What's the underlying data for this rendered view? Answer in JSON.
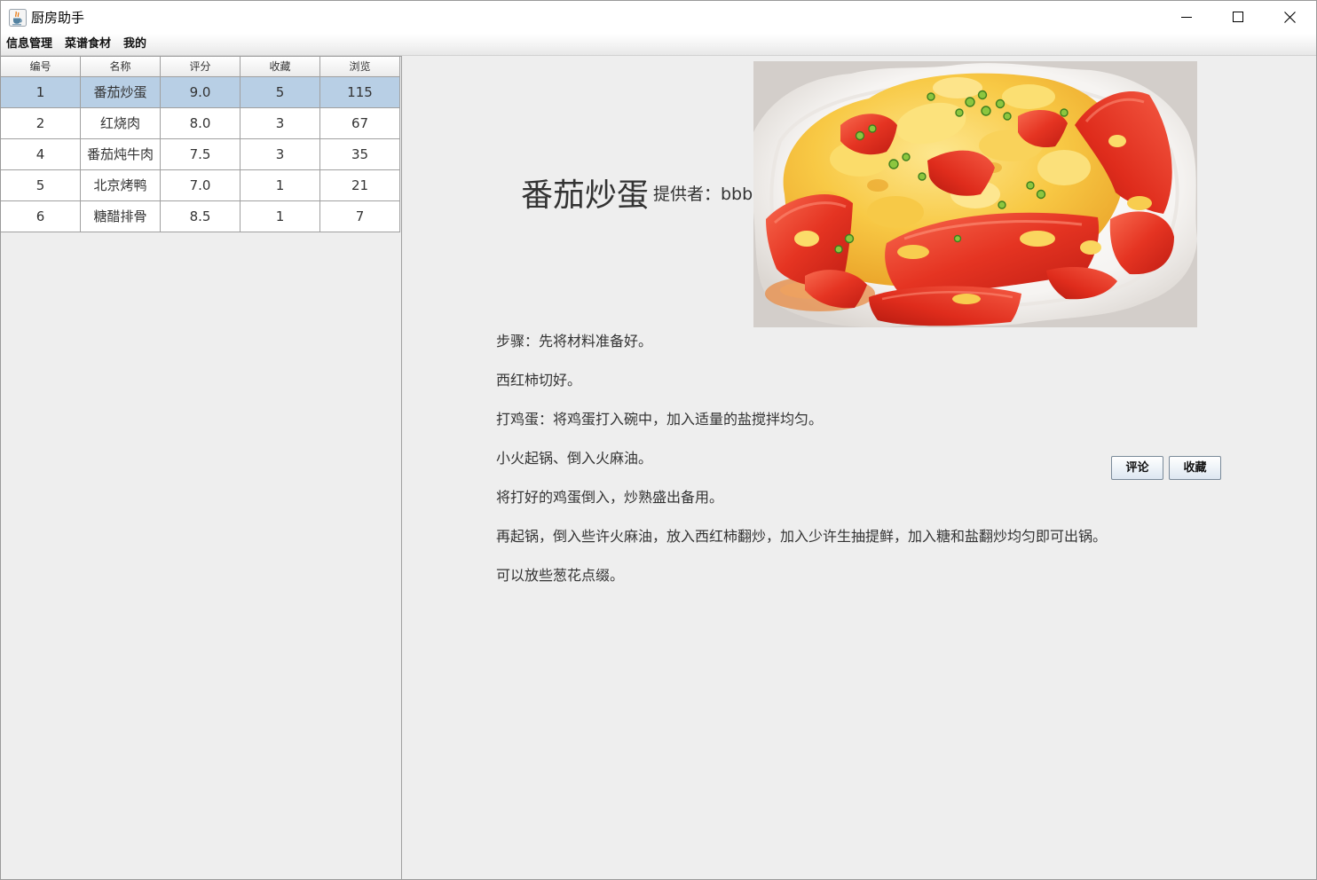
{
  "window": {
    "title": "厨房助手"
  },
  "icons": {
    "app": "java-coffee-icon",
    "minimize": "minimize-icon",
    "maximize": "maximize-icon",
    "close": "close-icon"
  },
  "menu": {
    "items": [
      {
        "label": "信息管理"
      },
      {
        "label": "菜谱食材"
      },
      {
        "label": "我的"
      }
    ]
  },
  "table": {
    "columns": [
      "编号",
      "名称",
      "评分",
      "收藏",
      "浏览"
    ],
    "rows": [
      {
        "id": "1",
        "name": "番茄炒蛋",
        "rating": "9.0",
        "favorites": "5",
        "views": "115",
        "selected": true
      },
      {
        "id": "2",
        "name": "红烧肉",
        "rating": "8.0",
        "favorites": "3",
        "views": "67",
        "selected": false
      },
      {
        "id": "4",
        "name": "番茄炖牛肉",
        "rating": "7.5",
        "favorites": "3",
        "views": "35",
        "selected": false
      },
      {
        "id": "5",
        "name": "北京烤鸭",
        "rating": "7.0",
        "favorites": "1",
        "views": "21",
        "selected": false
      },
      {
        "id": "6",
        "name": "糖醋排骨",
        "rating": "8.5",
        "favorites": "1",
        "views": "7",
        "selected": false
      }
    ]
  },
  "detail": {
    "title": "番茄炒蛋",
    "provider": "提供者：bbb",
    "steps": [
      "步骤：先将材料准备好。",
      "西红柿切好。",
      "打鸡蛋：将鸡蛋打入碗中，加入适量的盐搅拌均匀。",
      "小火起锅、倒入火麻油。",
      "将打好的鸡蛋倒入，炒熟盛出备用。",
      "再起锅，倒入些许火麻油，放入西红柿翻炒，加入少许生抽提鲜，加入糖和盐翻炒均匀即可出锅。",
      "可以放些葱花点缀。"
    ],
    "actions": {
      "comment": "评论",
      "favorite": "收藏"
    }
  },
  "colors": {
    "window_bg": "#eeeeee",
    "selected_row": "#b8cfe5",
    "grid_line": "#a0a0a0",
    "text": "#333333",
    "button_border": "#7a8a99"
  }
}
